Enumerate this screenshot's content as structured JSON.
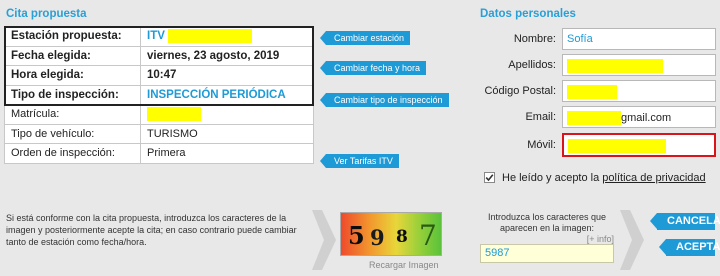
{
  "cita": {
    "title": "Cita propuesta",
    "main_rows": [
      {
        "label": "Estación propuesta:",
        "value": "ITV"
      },
      {
        "label": "Fecha elegida:",
        "value": "viernes, 23 agosto, 2019"
      },
      {
        "label": "Hora elegida:",
        "value": "10:47"
      },
      {
        "label": "Tipo de inspección:",
        "value": "INSPECCIÓN PERIÓDICA"
      }
    ],
    "extra_rows": [
      {
        "label": "Matrícula:",
        "value": ""
      },
      {
        "label": "Tipo de vehículo:",
        "value": "TURISMO"
      },
      {
        "label": "Orden de inspección:",
        "value": "Primera"
      }
    ]
  },
  "actions": {
    "cambiar_estacion": "Cambiar estación",
    "cambiar_fecha": "Cambiar fecha y hora",
    "cambiar_tipo": "Cambiar tipo de inspección",
    "ver_tarifas": "Ver Tarifas ITV"
  },
  "datos": {
    "title": "Datos personales",
    "fields": [
      {
        "label": "Nombre:",
        "value": "Sofía"
      },
      {
        "label": "Apellidos:",
        "value": ""
      },
      {
        "label": "Código Postal:",
        "value": ""
      },
      {
        "label": "Email:",
        "value": "gmail.com"
      },
      {
        "label": "Móvil:",
        "value": ""
      }
    ],
    "privacy_text": "He leído y acepto la",
    "privacy_link": "política de privacidad",
    "privacy_checked": true
  },
  "bottom": {
    "instructions": "Si está conforme con la cita propuesta, introduzca los caracteres de la imagen y posteriormente acepte la cita; en caso contrario puede cambiar tanto de estación como fecha/hora.",
    "captcha_chars": [
      "5",
      "9",
      "8",
      "7"
    ],
    "recargar": "Recargar Imagen",
    "intro": "Introduzca los caracteres que aparecen en la imagen:",
    "info": "[+ info]",
    "captcha_value": "5987",
    "cancelar": "CANCELAR",
    "aceptar": "ACEPTAR"
  },
  "colors": {
    "accent": "#1e9ad6",
    "highlight": "#ffff00",
    "error": "#d9141b"
  }
}
